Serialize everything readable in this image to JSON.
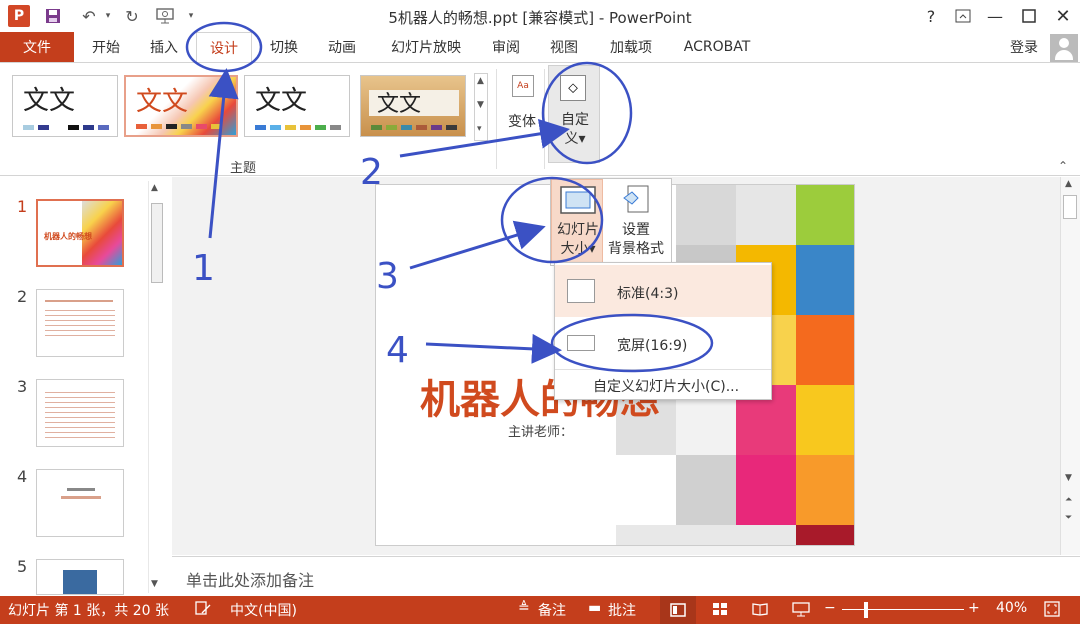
{
  "titlebar": {
    "app_icon": "P",
    "title": "5机器人的畅想.ppt [兼容模式] - PowerPoint",
    "help": "?",
    "icons": [
      "save-icon",
      "undo-icon",
      "redo-icon",
      "presentation-icon",
      "customize-icon",
      "ribbon-display-icon",
      "minimize-icon",
      "maximize-icon",
      "close-icon"
    ]
  },
  "tabs": {
    "file": "文件",
    "items": [
      "开始",
      "插入",
      "设计",
      "切换",
      "动画",
      "幻灯片放映",
      "审阅",
      "视图",
      "加载项",
      "ACROBAT"
    ],
    "active": "设计",
    "signin": "登录"
  },
  "ribbon": {
    "theme_sample": "文文",
    "theme_group_label": "主题",
    "variant_label": "变体",
    "custom_label_1": "自定",
    "custom_label_2": "义▾",
    "variant_icon_text": "Aa"
  },
  "dropdown": {
    "slide_size_1": "幻灯片",
    "slide_size_2": "大小▾",
    "background_1": "设置",
    "background_2": "背景格式",
    "standard": "标准(4:3)",
    "widescreen": "宽屏(16:9)",
    "custom_size": "自定义幻灯片大小(C)..."
  },
  "thumbnails": {
    "numbers": [
      "1",
      "2",
      "3",
      "4",
      "5"
    ],
    "thumb1_title": "机器人的畅想"
  },
  "slide": {
    "title": "机器人的畅想",
    "subtitle": "主讲老师："
  },
  "notes": {
    "placeholder": "单击此处添加备注"
  },
  "status": {
    "slide_info": "幻灯片 第 1 张，共 20 张",
    "language": "中文(中国)",
    "notes_btn": "备注",
    "comments_btn": "批注",
    "zoom": "40%",
    "zoom_level": 0.4
  },
  "annotations": [
    "1",
    "2",
    "3",
    "4"
  ],
  "colors": {
    "accent": "#c43e1c",
    "annotation": "#3b51c4"
  }
}
